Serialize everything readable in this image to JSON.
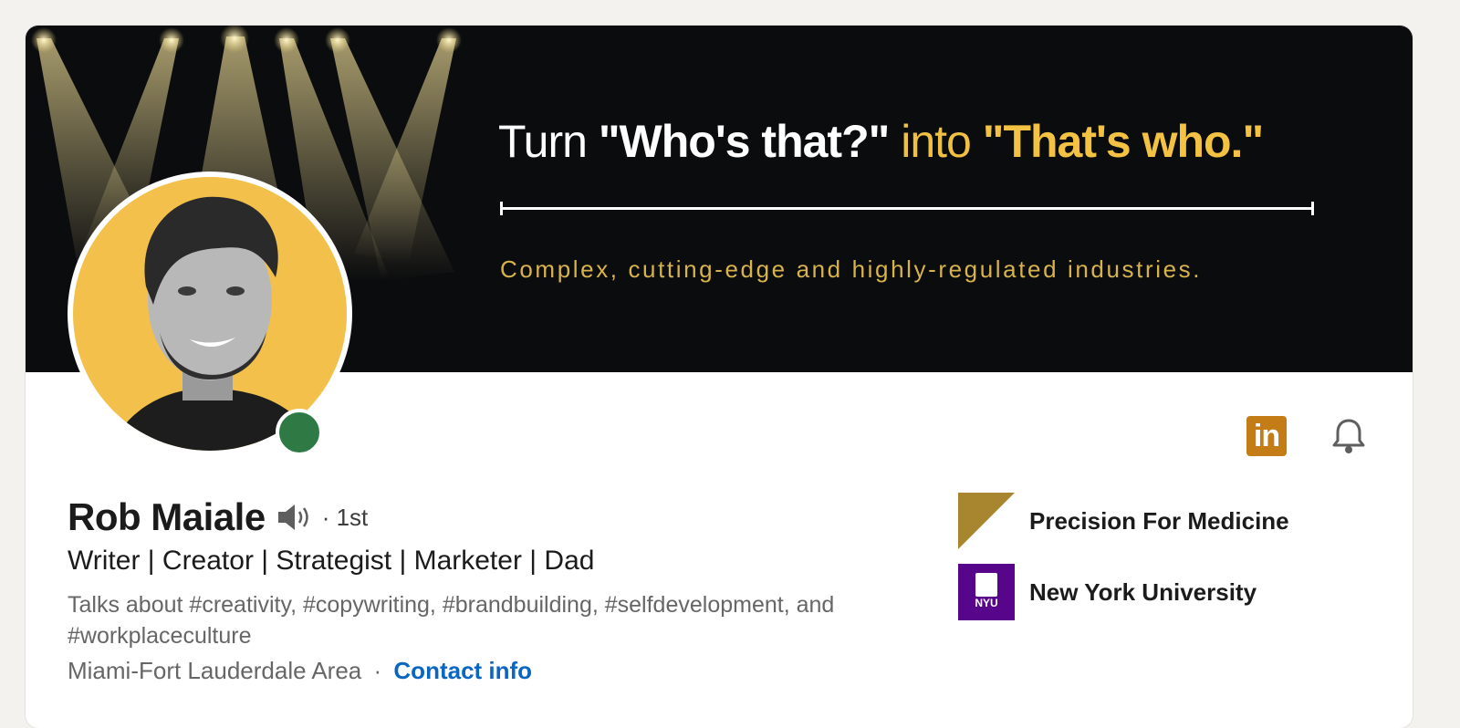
{
  "banner": {
    "headline_part1": "Turn ",
    "headline_part2": "\"Who's that?\"",
    "headline_part3": " into ",
    "headline_part4": "\"That's who.\"",
    "tagline": "Complex, cutting-edge and highly-regulated industries."
  },
  "profile": {
    "name": "Rob Maiale",
    "degree": "· 1st",
    "headline": "Writer | Creator | Strategist | Marketer | Dad",
    "talks_about": "Talks about #creativity, #copywriting, #brandbuilding, #selfdevelopment, and #workplaceculture",
    "location": "Miami-Fort Lauderdale Area",
    "separator": "·",
    "contact_link": "Contact info",
    "status": "online"
  },
  "actions": {
    "linkedin_icon_text": "in",
    "linkedin_icon": "linkedin-icon",
    "bell_icon": "bell-icon"
  },
  "organizations": [
    {
      "name": "Precision For Medicine",
      "logo": "precision-logo"
    },
    {
      "name": "New York University",
      "logo": "nyu-logo",
      "logo_text": "NYU"
    }
  ],
  "colors": {
    "banner_bg": "#0b0c0e",
    "accent_yellow": "#f4c243",
    "avatar_bg": "#f2c04b",
    "presence_green": "#2f7a44",
    "link_blue": "#0a66c2",
    "linkedin_orange": "#c47c16",
    "nyu_purple": "#57068c"
  }
}
